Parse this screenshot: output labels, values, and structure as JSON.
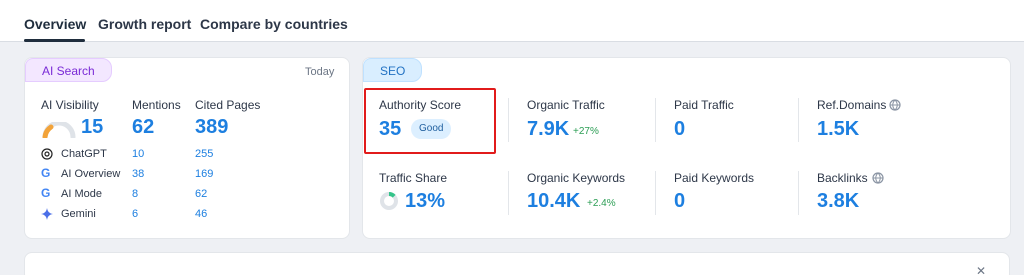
{
  "tabs": [
    {
      "label": "Overview"
    },
    {
      "label": "Growth report"
    },
    {
      "label": "Compare by countries"
    }
  ],
  "ai_search": {
    "pill": "AI Search",
    "today": "Today",
    "headers": {
      "visibility": "AI Visibility",
      "mentions": "Mentions",
      "cited": "Cited Pages"
    },
    "totals": {
      "visibility": "15",
      "mentions": "62",
      "cited": "389"
    },
    "rows": [
      {
        "name": "ChatGPT",
        "mentions": "10",
        "cited": "255",
        "icon": "chatgpt-icon"
      },
      {
        "name": "AI Overview",
        "mentions": "38",
        "cited": "169",
        "icon": "google-icon"
      },
      {
        "name": "AI Mode",
        "mentions": "8",
        "cited": "62",
        "icon": "google-icon"
      },
      {
        "name": "Gemini",
        "mentions": "6",
        "cited": "46",
        "icon": "gemini-icon"
      }
    ]
  },
  "seo": {
    "pill": "SEO",
    "authority": {
      "label": "Authority Score",
      "value": "35",
      "badge": "Good"
    },
    "organic_traffic": {
      "label": "Organic Traffic",
      "value": "7.9K",
      "delta": "+27%"
    },
    "paid_traffic": {
      "label": "Paid Traffic",
      "value": "0"
    },
    "ref_domains": {
      "label": "Ref.Domains",
      "value": "1.5K"
    },
    "traffic_share": {
      "label": "Traffic Share",
      "value": "13%",
      "share_fraction": 0.13
    },
    "organic_keywords": {
      "label": "Organic Keywords",
      "value": "10.4K",
      "delta": "+2.4%"
    },
    "paid_keywords": {
      "label": "Paid Keywords",
      "value": "0"
    },
    "backlinks": {
      "label": "Backlinks",
      "value": "3.8K"
    }
  },
  "colors": {
    "accent": "#1d7fe0",
    "positive": "#2c9e55",
    "highlight": "#e11b1b"
  }
}
